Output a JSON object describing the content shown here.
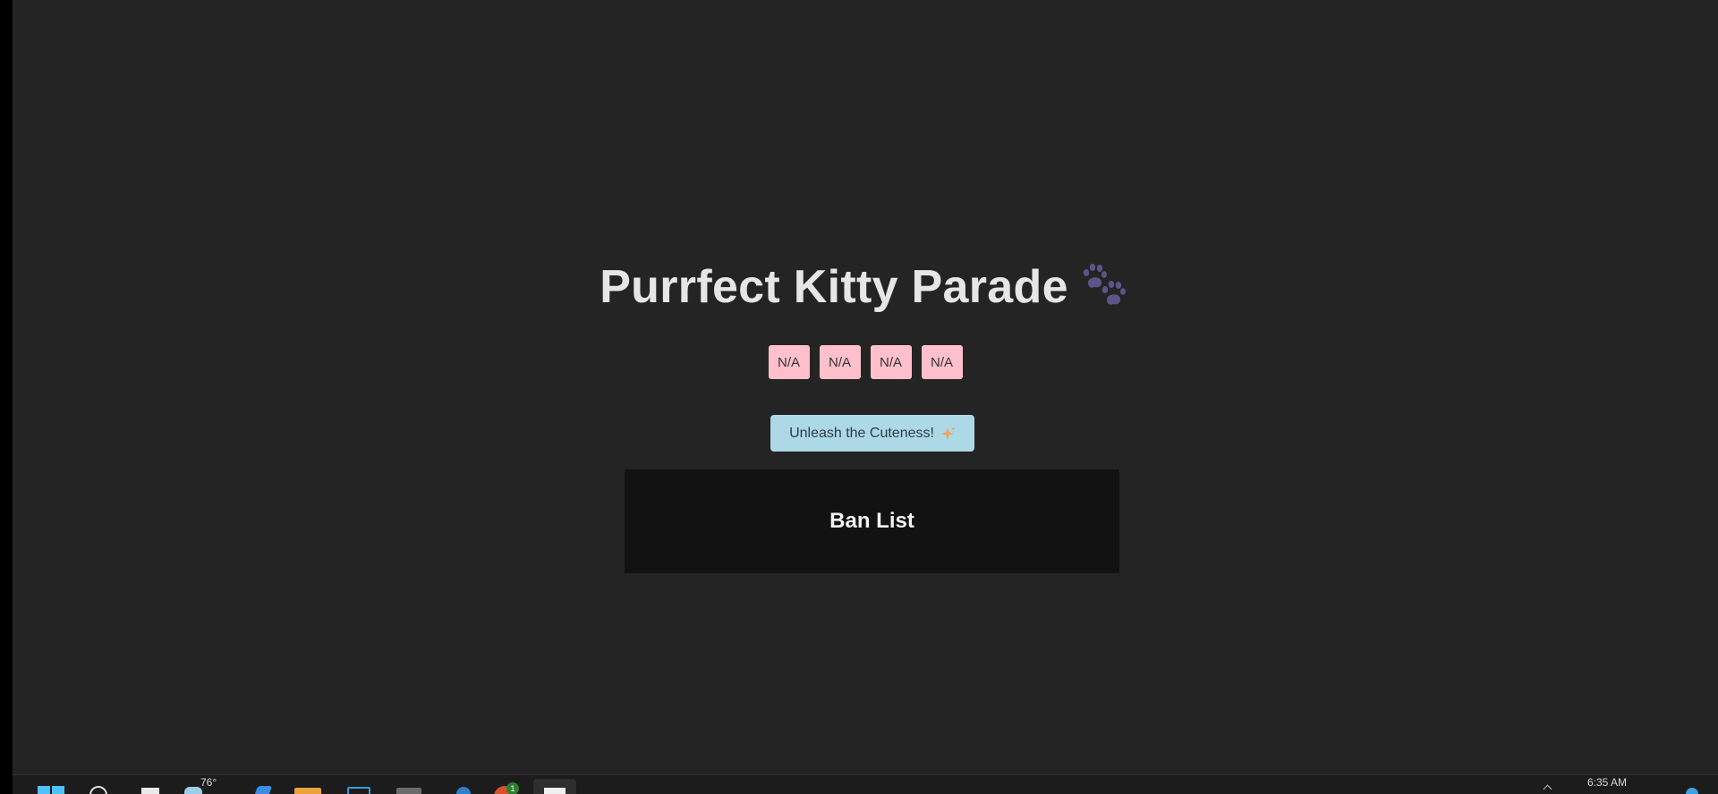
{
  "app": {
    "title": "Purrfect Kitty Parade",
    "title_icon": "paw-prints-icon",
    "attributes": [
      "N/A",
      "N/A",
      "N/A",
      "N/A"
    ],
    "discover_label": "Unleash the Cuteness!",
    "discover_icon": "sparkle-icon",
    "ban_list_title": "Ban List"
  },
  "taskbar": {
    "weather_temp": "76°",
    "clock": "6:35 AM",
    "notification_badge": "1",
    "icons": [
      "windows-start-icon",
      "search-icon",
      "task-view-icon",
      "weather-icon",
      "browser-icon",
      "file-explorer-icon",
      "remote-desktop-icon",
      "app-icon",
      "edge-icon",
      "chrome-icon",
      "terminal-icon"
    ]
  },
  "colors": {
    "background": "#242424",
    "title": "#e6e6e6",
    "attribute_button": "#ffc0cb",
    "discover_button": "#add8e6",
    "ban_panel": "#121212",
    "paw": "#5d5487",
    "sparkle": "#f3a35c"
  }
}
